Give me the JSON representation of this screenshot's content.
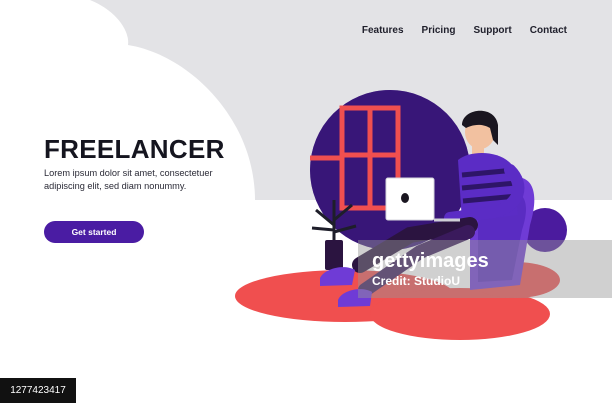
{
  "nav": {
    "items": [
      {
        "label": "Features"
      },
      {
        "label": "Pricing"
      },
      {
        "label": "Support"
      },
      {
        "label": "Contact"
      }
    ]
  },
  "hero": {
    "title": "FREELANCER",
    "description": "Lorem ipsum dolor sit amet, consectetuer adipiscing elit, sed diam nonummy.",
    "cta_label": "Get started"
  },
  "watermark": {
    "brand": "gettyimages",
    "credit": "Credit: StudioU",
    "image_id": "1277423417"
  },
  "colors": {
    "accent": "#4a1ca3",
    "purple_circle": "#4b1b9e",
    "rug": "#f04f4f",
    "backdrop": "#e3e3e6"
  }
}
